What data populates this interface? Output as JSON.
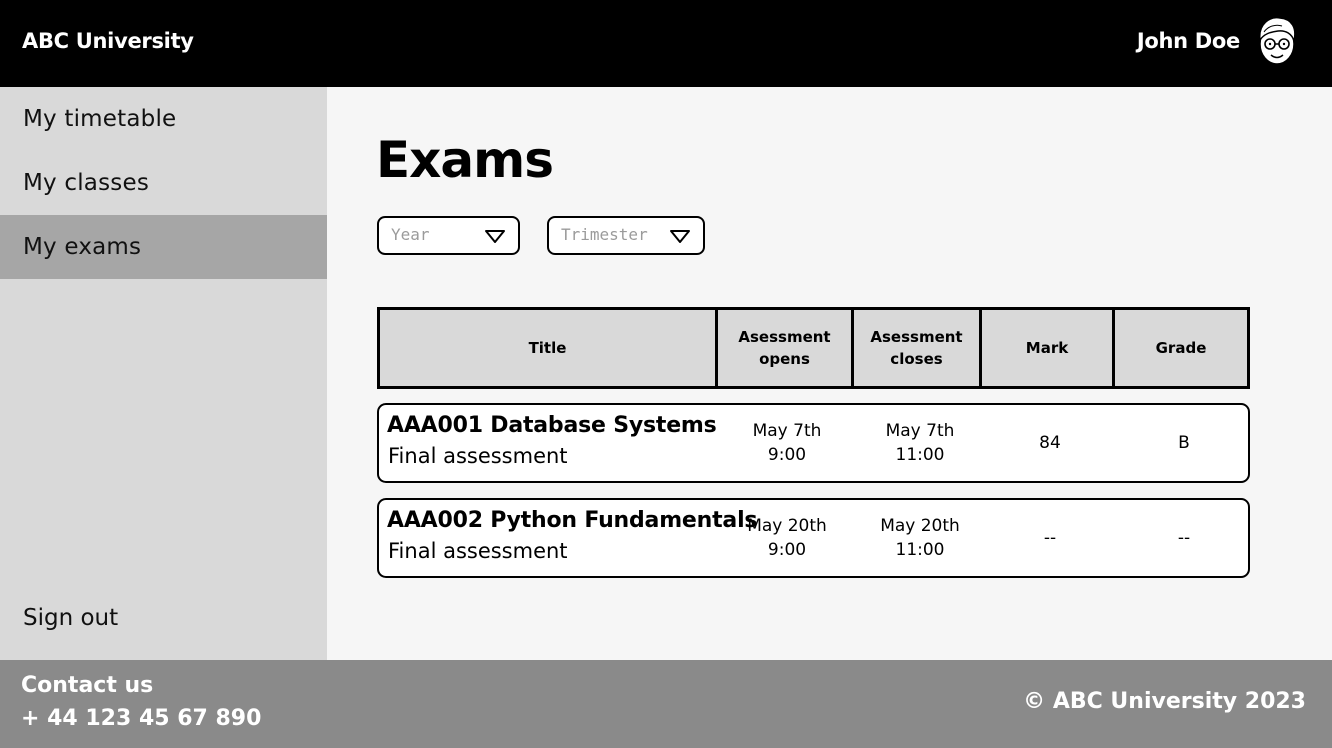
{
  "header": {
    "brand": "ABC University",
    "user_name": "John Doe",
    "avatar_icon": "user-avatar-icon"
  },
  "sidebar": {
    "items": [
      {
        "label": "My timetable",
        "active": false
      },
      {
        "label": "My classes",
        "active": false
      },
      {
        "label": "My exams",
        "active": true
      }
    ],
    "sign_out": "Sign out"
  },
  "main": {
    "title": "Exams",
    "filters": {
      "year_placeholder": "Year",
      "trimester_placeholder": "Trimester"
    },
    "table": {
      "headers": [
        "Title",
        "Asessment opens",
        "Asessment closes",
        "Mark",
        "Grade"
      ],
      "header_lines": {
        "open": [
          "Asessment",
          "opens"
        ],
        "close": [
          "Asessment",
          "closes"
        ]
      },
      "rows": [
        {
          "course": "AAA001 Database Systems",
          "assessment": "Final assessment",
          "opens_date": "May 7th",
          "opens_time": "9:00",
          "closes_date": "May 7th",
          "closes_time": "11:00",
          "mark": "84",
          "grade": "B"
        },
        {
          "course": "AAA002 Python Fundamentals",
          "assessment": "Final assessment",
          "opens_date": "May 20th",
          "opens_time": "9:00",
          "closes_date": "May 20th",
          "closes_time": "11:00",
          "mark": "--",
          "grade": "--"
        }
      ]
    }
  },
  "footer": {
    "contact_label": "Contact us",
    "phone": "+ 44 123 45 67 890",
    "copyright": "© ABC University 2023"
  },
  "colors": {
    "header_bg": "#000000",
    "sidebar_bg": "#d9d9d9",
    "sidebar_active_bg": "#a6a6a6",
    "main_bg": "#f6f6f6",
    "table_header_bg": "#d9d9d9",
    "footer_bg": "#8a8a8a"
  }
}
